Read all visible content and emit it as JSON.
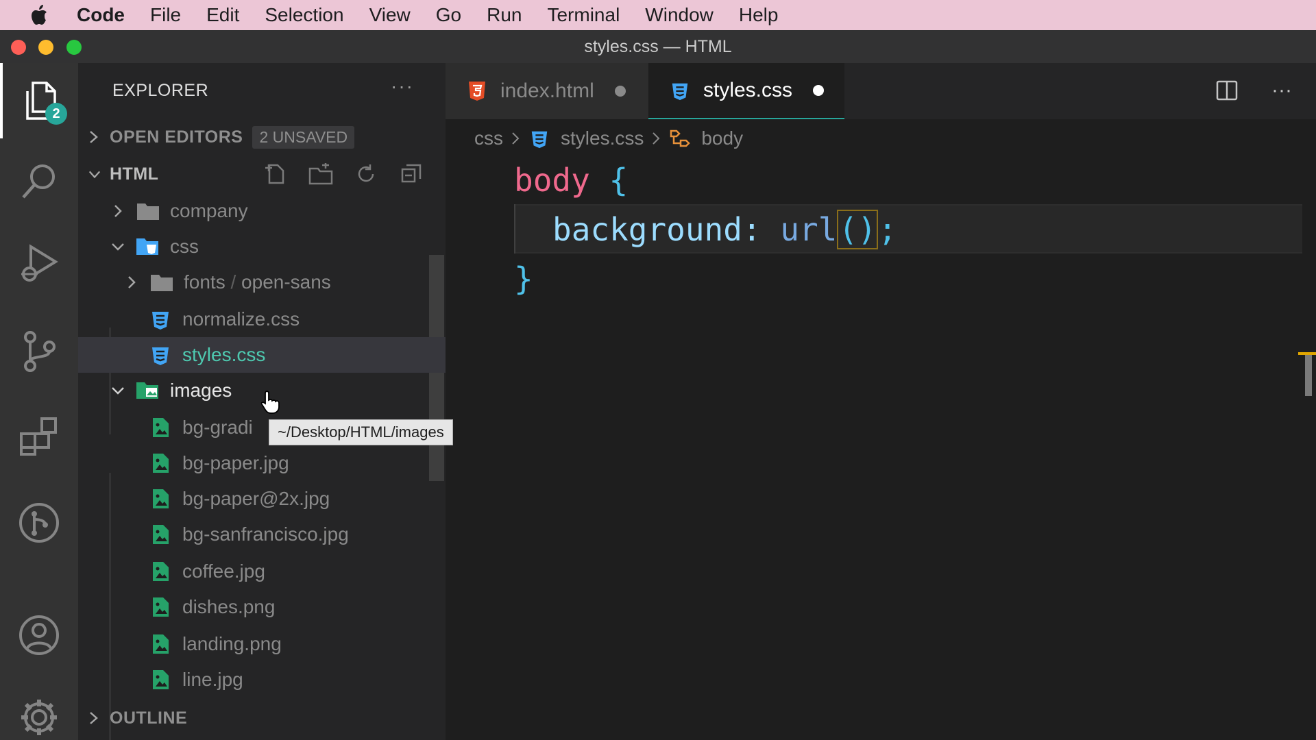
{
  "menubar": {
    "app": "Code",
    "items": [
      "File",
      "Edit",
      "Selection",
      "View",
      "Go",
      "Run",
      "Terminal",
      "Window",
      "Help"
    ]
  },
  "window": {
    "title": "styles.css — HTML"
  },
  "activity": {
    "explorer_badge": "2"
  },
  "sidebar": {
    "title": "EXPLORER",
    "open_editors": {
      "label": "OPEN EDITORS",
      "badge": "2 UNSAVED"
    },
    "folder": {
      "label": "HTML"
    },
    "tree": [
      {
        "name": "company",
        "type": "folder"
      },
      {
        "name": "css",
        "type": "folder-open"
      },
      {
        "name": "fonts",
        "sub": "open-sans",
        "type": "folder"
      },
      {
        "name": "normalize.css",
        "type": "css"
      },
      {
        "name": "styles.css",
        "type": "css"
      },
      {
        "name": "images",
        "type": "folder-open"
      },
      {
        "name": "bg-gradi",
        "type": "image"
      },
      {
        "name": "bg-paper.jpg",
        "type": "image"
      },
      {
        "name": "bg-paper@2x.jpg",
        "type": "image"
      },
      {
        "name": "bg-sanfrancisco.jpg",
        "type": "image"
      },
      {
        "name": "coffee.jpg",
        "type": "image"
      },
      {
        "name": "dishes.png",
        "type": "image"
      },
      {
        "name": "landing.png",
        "type": "image"
      },
      {
        "name": "line.jpg",
        "type": "image"
      }
    ],
    "outline": {
      "label": "OUTLINE"
    },
    "tooltip": "~/Desktop/HTML/images"
  },
  "tabs": [
    {
      "label": "index.html",
      "dirty": true,
      "active": false
    },
    {
      "label": "styles.css",
      "dirty": true,
      "active": true
    }
  ],
  "breadcrumb": {
    "folder": "css",
    "file": "styles.css",
    "symbol": "body"
  },
  "code": {
    "line1_selector": "body",
    "line1_brace": "{",
    "line2_prop": "background",
    "line2_colon": ":",
    "line2_fn": "url",
    "line2_paren": "()",
    "line2_semi": ";",
    "line3_brace": "}"
  },
  "colors": {
    "menubar": "#ecc6d6",
    "accent": "#27a69a",
    "css_icon": "#42a5f5",
    "html_icon": "#e44d26",
    "image_icon": "#26a269"
  }
}
